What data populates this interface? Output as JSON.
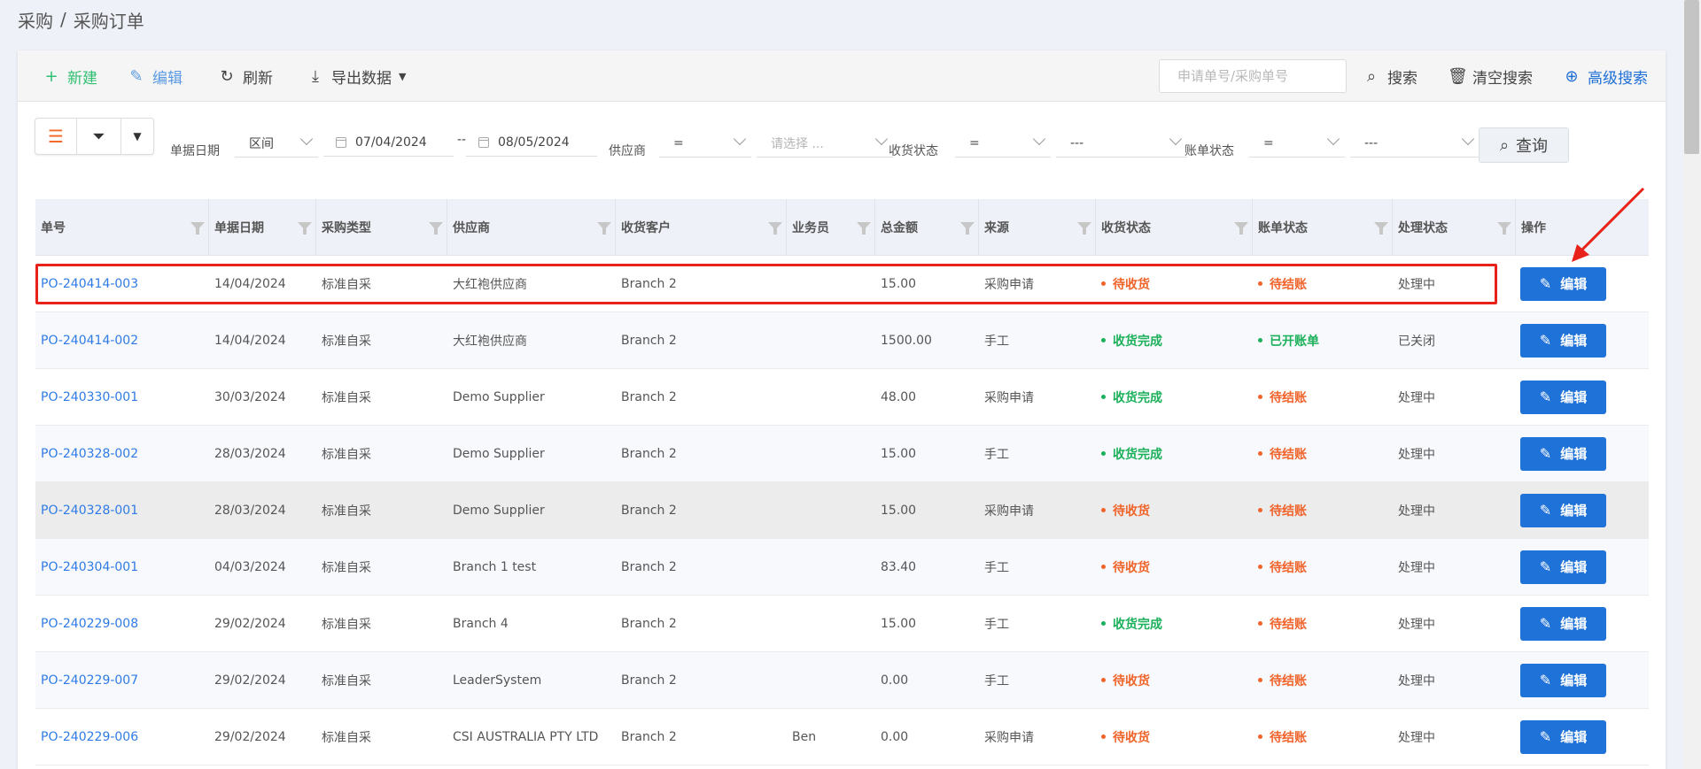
{
  "breadcrumb": {
    "root": "采购",
    "separator": "/",
    "current": "采购订单"
  },
  "toolbar": {
    "new_label": "新建",
    "edit_label": "编辑",
    "refresh_label": "刷新",
    "export_label": "导出数据",
    "search_placeholder": "申请单号/采购单号",
    "search_label": "搜索",
    "clear_label": "清空搜索",
    "advanced_label": "高级搜索"
  },
  "filters": {
    "date_label": "单据日期",
    "date_mode": "区间",
    "date_from": "07/04/2024",
    "date_sep": "--",
    "date_to": "08/05/2024",
    "supplier_label": "供应商",
    "supplier_op": "=",
    "supplier_placeholder": "请选择 ...",
    "receive_label": "收货状态",
    "receive_op": "=",
    "receive_value": "---",
    "bill_label": "账单状态",
    "bill_op": "=",
    "bill_value": "---",
    "query_label": "查询"
  },
  "table": {
    "columns": [
      "单号",
      "单据日期",
      "采购类型",
      "供应商",
      "收货客户",
      "业务员",
      "总金额",
      "来源",
      "收货状态",
      "账单状态",
      "处理状态",
      "操作"
    ],
    "edit_label": "编辑",
    "rows": [
      {
        "no": "PO-240414-003",
        "date": "14/04/2024",
        "type": "标准自采",
        "supplier": "大红袍供应商",
        "customer": "Branch 2",
        "sales": "",
        "amount": "15.00",
        "source": "采购申请",
        "receive": "待收货",
        "receive_color": "orange",
        "bill": "待结账",
        "bill_color": "orange",
        "process": "处理中"
      },
      {
        "no": "PO-240414-002",
        "date": "14/04/2024",
        "type": "标准自采",
        "supplier": "大红袍供应商",
        "customer": "Branch 2",
        "sales": "",
        "amount": "1500.00",
        "source": "手工",
        "receive": "收货完成",
        "receive_color": "green",
        "bill": "已开账单",
        "bill_color": "green",
        "process": "已关闭"
      },
      {
        "no": "PO-240330-001",
        "date": "30/03/2024",
        "type": "标准自采",
        "supplier": "Demo Supplier",
        "customer": "Branch 2",
        "sales": "",
        "amount": "48.00",
        "source": "采购申请",
        "receive": "收货完成",
        "receive_color": "green",
        "bill": "待结账",
        "bill_color": "orange",
        "process": "处理中"
      },
      {
        "no": "PO-240328-002",
        "date": "28/03/2024",
        "type": "标准自采",
        "supplier": "Demo Supplier",
        "customer": "Branch 2",
        "sales": "",
        "amount": "15.00",
        "source": "手工",
        "receive": "收货完成",
        "receive_color": "green",
        "bill": "待结账",
        "bill_color": "orange",
        "process": "处理中"
      },
      {
        "no": "PO-240328-001",
        "date": "28/03/2024",
        "type": "标准自采",
        "supplier": "Demo Supplier",
        "customer": "Branch 2",
        "sales": "",
        "amount": "15.00",
        "source": "采购申请",
        "receive": "待收货",
        "receive_color": "orange",
        "bill": "待结账",
        "bill_color": "orange",
        "process": "处理中"
      },
      {
        "no": "PO-240304-001",
        "date": "04/03/2024",
        "type": "标准自采",
        "supplier": "Branch 1 test",
        "customer": "Branch 2",
        "sales": "",
        "amount": "83.40",
        "source": "手工",
        "receive": "待收货",
        "receive_color": "orange",
        "bill": "待结账",
        "bill_color": "orange",
        "process": "处理中"
      },
      {
        "no": "PO-240229-008",
        "date": "29/02/2024",
        "type": "标准自采",
        "supplier": "Branch 4",
        "customer": "Branch 2",
        "sales": "",
        "amount": "15.00",
        "source": "手工",
        "receive": "收货完成",
        "receive_color": "green",
        "bill": "待结账",
        "bill_color": "orange",
        "process": "处理中"
      },
      {
        "no": "PO-240229-007",
        "date": "29/02/2024",
        "type": "标准自采",
        "supplier": "LeaderSystem",
        "customer": "Branch 2",
        "sales": "",
        "amount": "0.00",
        "source": "手工",
        "receive": "待收货",
        "receive_color": "orange",
        "bill": "待结账",
        "bill_color": "orange",
        "process": "处理中"
      },
      {
        "no": "PO-240229-006",
        "date": "29/02/2024",
        "type": "标准自采",
        "supplier": "CSI AUSTRALIA PTY LTD",
        "customer": "Branch 2",
        "sales": "Ben",
        "amount": "0.00",
        "source": "采购申请",
        "receive": "待收货",
        "receive_color": "orange",
        "bill": "待结账",
        "bill_color": "orange",
        "process": "处理中"
      }
    ]
  }
}
